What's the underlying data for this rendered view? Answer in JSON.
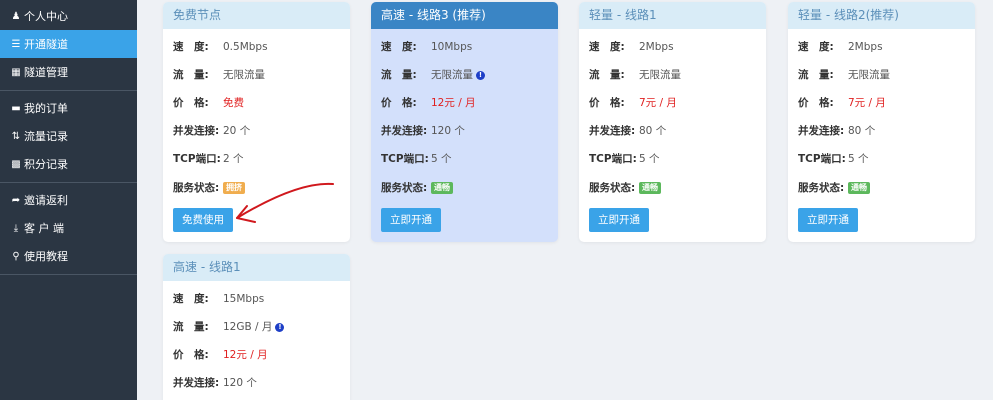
{
  "sidebar": {
    "items": [
      {
        "label": "个人中心",
        "icon": "user-icon"
      },
      {
        "label": "开通隧道",
        "icon": "list-icon"
      },
      {
        "label": "隧道管理",
        "icon": "table-icon"
      },
      {
        "label": "我的订单",
        "icon": "card-icon"
      },
      {
        "label": "流量记录",
        "icon": "sort-icon"
      },
      {
        "label": "积分记录",
        "icon": "grid-icon"
      },
      {
        "label": "邀请返利",
        "icon": "share-icon"
      },
      {
        "label": "客 户 端",
        "icon": "download-icon"
      },
      {
        "label": "使用教程",
        "icon": "search-icon"
      }
    ],
    "active_label": "开通隧道"
  },
  "labels": {
    "speed": "速　度:",
    "traffic": "流　量:",
    "price": "价　格:",
    "concurrent": "并发连接:",
    "tcp": "TCP端口:",
    "status": "服务状态:"
  },
  "cards": [
    {
      "title": "免费节点",
      "speed": "0.5Mbps",
      "traffic": "无限流量",
      "price": "免费",
      "concurrent": "20 个",
      "tcp": "2 个",
      "status": "拥挤",
      "button": "免费使用"
    },
    {
      "title": "高速 - 线路3 (推荐)",
      "speed": "10Mbps",
      "traffic": "无限流量",
      "price": "12元 / 月",
      "concurrent": "120 个",
      "tcp": "5 个",
      "status": "通畅",
      "button": "立即开通"
    },
    {
      "title": "轻量 - 线路1",
      "speed": "2Mbps",
      "traffic": "无限流量",
      "price": "7元 / 月",
      "concurrent": "80 个",
      "tcp": "5 个",
      "status": "通畅",
      "button": "立即开通"
    },
    {
      "title": "轻量 - 线路2(推荐)",
      "speed": "2Mbps",
      "traffic": "无限流量",
      "price": "7元 / 月",
      "concurrent": "80 个",
      "tcp": "5 个",
      "status": "通畅",
      "button": "立即开通"
    },
    {
      "title": "高速 - 线路1",
      "speed": "15Mbps",
      "traffic": "12GB / 月",
      "price": "12元 / 月",
      "concurrent": "120 个"
    }
  ],
  "colors": {
    "accent": "#3aa3e8",
    "price": "#e02020",
    "sidebar": "#2b3643",
    "busy": "#f0ad4e",
    "ok": "#5cb85c"
  }
}
